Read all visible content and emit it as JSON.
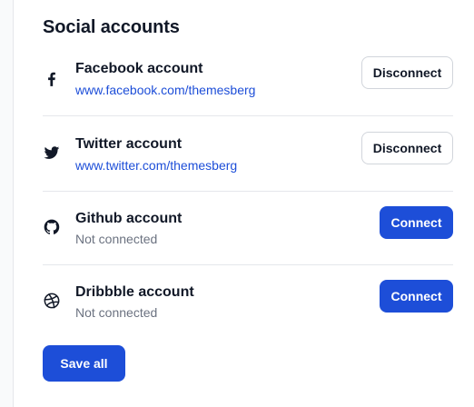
{
  "section": {
    "title": "Social accounts"
  },
  "accounts": [
    {
      "icon": "facebook-icon",
      "name": "Facebook account",
      "subtitle": "www.facebook.com/themesberg",
      "subtitle_style": "link",
      "action": "Disconnect",
      "action_style": "outline"
    },
    {
      "icon": "twitter-icon",
      "name": "Twitter account",
      "subtitle": "www.twitter.com/themesberg",
      "subtitle_style": "link",
      "action": "Disconnect",
      "action_style": "outline"
    },
    {
      "icon": "github-icon",
      "name": "Github account",
      "subtitle": "Not connected",
      "subtitle_style": "muted",
      "action": "Connect",
      "action_style": "primary"
    },
    {
      "icon": "dribbble-icon",
      "name": "Dribbble account",
      "subtitle": "Not connected",
      "subtitle_style": "muted",
      "action": "Connect",
      "action_style": "primary"
    }
  ],
  "footer": {
    "save_label": "Save all"
  },
  "colors": {
    "accent": "#1d4ed8",
    "link": "#1d4ed8",
    "muted": "#6b7280",
    "divider": "#e5e7eb"
  }
}
